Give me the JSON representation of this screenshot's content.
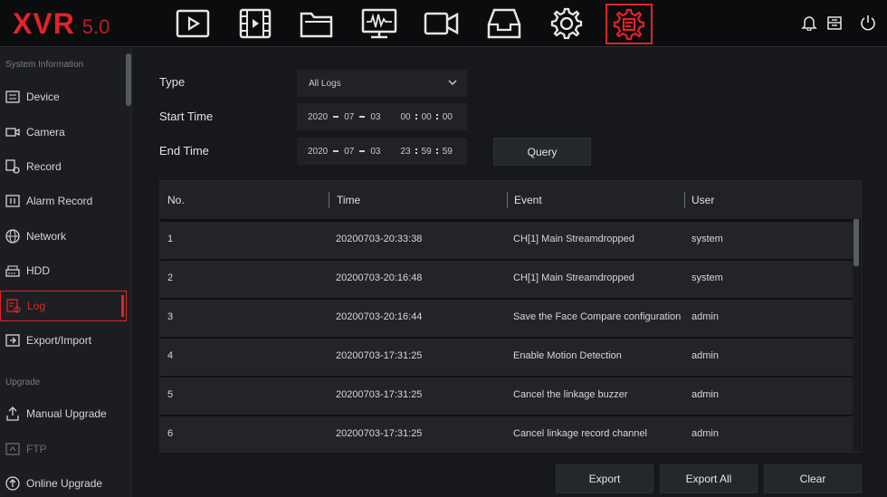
{
  "app": {
    "logo_main": "XVR",
    "logo_version": "5.0"
  },
  "topnav": [
    {
      "name": "playback-icon"
    },
    {
      "name": "video-clip-icon"
    },
    {
      "name": "folder-icon"
    },
    {
      "name": "monitor-icon"
    },
    {
      "name": "camera-icon"
    },
    {
      "name": "inbox-icon"
    },
    {
      "name": "gear-icon"
    },
    {
      "name": "system-settings-icon",
      "active": true
    }
  ],
  "topright": [
    "bell-icon",
    "storage-icon",
    "power-icon"
  ],
  "sidebar": {
    "section1": "System Information",
    "section2": "Upgrade",
    "items": [
      {
        "label": "Device",
        "icon": "device-icon"
      },
      {
        "label": "Camera",
        "icon": "camera-icon"
      },
      {
        "label": "Record",
        "icon": "record-icon"
      },
      {
        "label": "Alarm Record",
        "icon": "alarm-record-icon"
      },
      {
        "label": "Network",
        "icon": "globe-icon"
      },
      {
        "label": "HDD",
        "icon": "hdd-icon"
      },
      {
        "label": "Log",
        "icon": "log-icon",
        "active": true
      },
      {
        "label": "Export/Import",
        "icon": "export-icon"
      },
      {
        "label": "Manual Upgrade",
        "icon": "upgrade-icon"
      },
      {
        "label": "FTP",
        "icon": "ftp-icon",
        "disabled": true
      },
      {
        "label": "Online Upgrade",
        "icon": "online-upgrade-icon"
      }
    ]
  },
  "form": {
    "type_label": "Type",
    "type_value": "All Logs",
    "start_label": "Start Time",
    "start": {
      "year": "2020",
      "month": "07",
      "day": "03",
      "hh": "00",
      "mm": "00",
      "ss": "00"
    },
    "end_label": "End Time",
    "end": {
      "year": "2020",
      "month": "07",
      "day": "03",
      "hh": "23",
      "mm": "59",
      "ss": "59"
    },
    "query_label": "Query"
  },
  "table": {
    "headers": [
      "No.",
      "Time",
      "Event",
      "User"
    ],
    "rows": [
      {
        "no": "1",
        "time": "20200703-20:33:38",
        "event": "CH[1] Main Streamdropped",
        "user": "system"
      },
      {
        "no": "2",
        "time": "20200703-20:16:48",
        "event": "CH[1] Main Streamdropped",
        "user": "system"
      },
      {
        "no": "3",
        "time": "20200703-20:16:44",
        "event": "Save the Face Compare configuration",
        "user": "admin"
      },
      {
        "no": "4",
        "time": "20200703-17:31:25",
        "event": "Enable Motion Detection",
        "user": "admin"
      },
      {
        "no": "5",
        "time": "20200703-17:31:25",
        "event": "Cancel the linkage buzzer",
        "user": "admin"
      },
      {
        "no": "6",
        "time": "20200703-17:31:25",
        "event": "Cancel linkage record channel",
        "user": "admin"
      }
    ]
  },
  "buttons": {
    "export": "Export",
    "export_all": "Export All",
    "clear": "Clear"
  },
  "colors": {
    "accent": "#e0242a",
    "background": "#16181b",
    "row": "#222428"
  }
}
